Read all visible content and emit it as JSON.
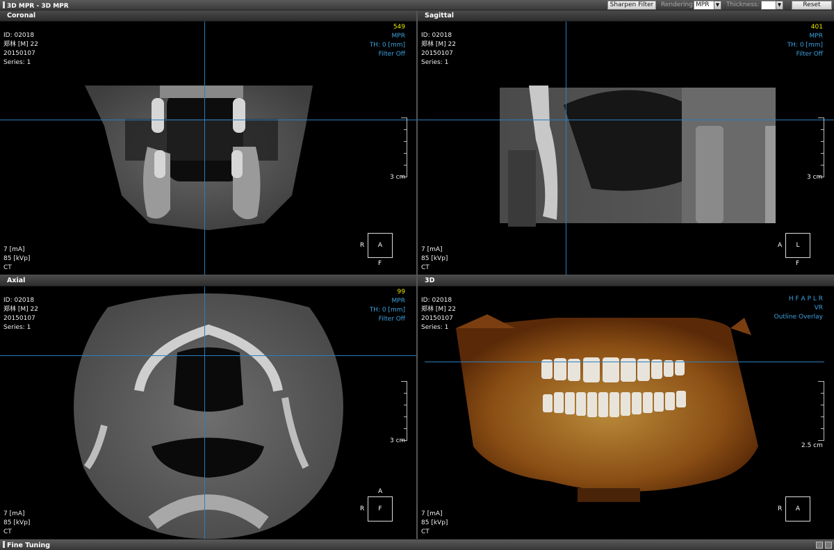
{
  "app": {
    "title": "3D MPR - 3D MPR"
  },
  "toolbar": {
    "sharpen_label": "Sharpen Filter",
    "rendering_label": "Rendering:",
    "rendering_value": "MPR",
    "thickness_label": "Thickness:",
    "thickness_value": "",
    "reset_label": "Reset"
  },
  "patient": {
    "id": "ID: 02018",
    "name": "郑林 [M] 22",
    "date": "20150107",
    "series": "Series: 1",
    "ma": "7 [mA]",
    "kvp": "85 [kVp]",
    "modality": "CT"
  },
  "viewports": {
    "coronal": {
      "title": "Coronal",
      "slice": "549",
      "mode": "MPR",
      "thickness": "TH: 0 [mm]",
      "filter": "Filter Off",
      "scale": "3 cm",
      "orient_left": "R",
      "orient_center": "A",
      "orient_bottom": "F"
    },
    "sagittal": {
      "title": "Sagittal",
      "slice": "401",
      "mode": "MPR",
      "thickness": "TH: 0 [mm]",
      "filter": "Filter Off",
      "scale": "3 cm",
      "orient_left": "A",
      "orient_center": "L",
      "orient_bottom": "F"
    },
    "axial": {
      "title": "Axial",
      "slice": "99",
      "mode": "MPR",
      "thickness": "TH: 0 [mm]",
      "filter": "Filter Off",
      "scale": "3 cm",
      "orient_top": "A",
      "orient_left": "R",
      "orient_center": "F"
    },
    "volume": {
      "title": "3D",
      "orient_letters": "H F A P L R",
      "mode": "VR",
      "overlay": "Outline Overlay",
      "scale": "2.5 cm",
      "orient_left": "R",
      "orient_center": "A"
    }
  },
  "bottom": {
    "title": "Fine Tuning"
  },
  "colors": {
    "crosshair": "#2a7fc0",
    "slice_number": "#e8e800",
    "overlay_text": "#3da2e0"
  }
}
